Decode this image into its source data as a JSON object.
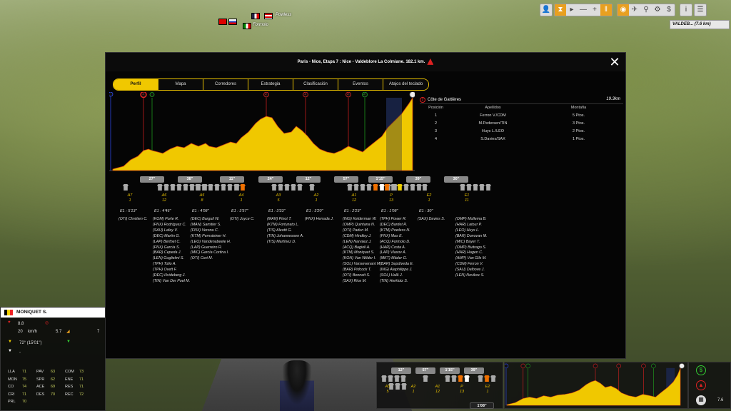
{
  "flags": {
    "labels": [
      "Powless",
      "Formolo"
    ]
  },
  "toolbar": {
    "location": "VALDEB... (7.6 km)"
  },
  "modal": {
    "title": "Paris - Nice, Etapa 7 : Nice - Valdeblore La Colmiane. 182.1 km."
  },
  "tabs": [
    "Perfil",
    "Mapa",
    "Corredores",
    "Estrategia",
    "Clasificación",
    "Eventos",
    "Atajos del teclado"
  ],
  "profile_markers": [
    "1",
    "2",
    "1",
    "2",
    "2"
  ],
  "climb": {
    "number": "2",
    "name": "Côte de Gattières",
    "distance": "19.3km",
    "headers": [
      "Posición",
      "Apellidos",
      "Montaña"
    ],
    "rows": [
      [
        "1",
        "Ferron V./CDM",
        "5 Ptos."
      ],
      [
        "2",
        "M.Pedersen/TIN",
        "3 Ptos."
      ],
      [
        "3",
        "Huys L./LEO",
        "2 Ptos."
      ],
      [
        "4",
        "S.Davies/SAX",
        "1 Ptos."
      ]
    ]
  },
  "gaps": [
    "27''",
    "38''",
    "11''",
    "24''",
    "12''",
    "57''",
    "1'15''",
    "39''",
    "30''"
  ],
  "groups": [
    {
      "label": "A7",
      "count": "1",
      "time": "E1 : 5'13''",
      "riders": [
        "(OTI) Chrétien C."
      ]
    },
    {
      "label": "A6",
      "count": "12",
      "time": "E1 : 4'46''",
      "riders": [
        "(KOM) Porte R.",
        "(FNX) Rodríguez C.",
        "(SAU) Lafay V.",
        "(DEC) Martin G.",
        "(LAP) Berthet C.",
        "(FNX) García S.",
        "(BAR) Cepeda J.",
        "(LEN) Guglielmi S.",
        "(TPH) Tolio A.",
        "(TPH) Ovett F.",
        "(DEC) Hvideberg J.",
        "(TIN) Van Der Poel M."
      ]
    },
    {
      "label": "A5",
      "count": "8",
      "time": "E1 : 4'08''",
      "riders": [
        "(DEC) Barguil W.",
        "(MAN) Samitier S.",
        "(FNX) Verona C.",
        "(KTM) Pernsteiner H.",
        "(LEO) Vandenabeele H.",
        "(LAP) Guerreiro R.",
        "(MIC) García Cortina I.",
        "(OTI) Cort M."
      ]
    },
    {
      "label": "A4",
      "count": "1",
      "time": "E1 : 3'57''",
      "riders": [
        "(OTI) Joyce C."
      ]
    },
    {
      "label": "A3",
      "count": "5",
      "time": "E1 : 3'33''",
      "riders": [
        "(MAN) Pinot T.",
        "(KTM) Fortunato L.",
        "(TIS) Aleotti G.",
        "(TIN) Johannessen A.",
        "(TIS) Martínez D."
      ]
    },
    {
      "label": "A2",
      "count": "1",
      "time": "E1 : 3'20''",
      "riders": [
        "(FNX) Herrada J."
      ]
    },
    {
      "label": "A1",
      "count": "12",
      "time": "E1 : 2'23''",
      "riders": [
        "(ING) Kelderman W.",
        "(OMP) Quintana N.",
        "(OTI) Padun M.",
        "(CDM) Hindley J.",
        "(LEN) Narváez J.",
        "(ACQ) Bagioli A.",
        "(KTM) Moniquet S.",
        "(KON) Van Wilder I.",
        "(SOL) Vansevenant M.",
        "(BAR) Pidcock T.",
        "(OTI) Bennett S.",
        "(SAX) Rice M."
      ]
    },
    {
      "label": "P",
      "count": "13",
      "time": "E1 : 1'08''",
      "riders": [
        "(TPH) Power R.",
        "(DEC) Bardet R.",
        "(KTM) Powless N.",
        "(FNX) Mas E.",
        "(ACQ) Formolo D.",
        "(HAR) Costa A.",
        "(LAP) Vlasov A.",
        "(MKT) Mäder G.",
        "(BAR) Sepúlveda E.",
        "(ING) Alaphilippe J.",
        "(SOL) Hală J.",
        "(TIN) Herklotz S."
      ]
    },
    {
      "label": "E2",
      "count": "1",
      "time": "E1 : 30''",
      "riders": [
        "(SAX) Davies S."
      ]
    },
    {
      "label": "E1",
      "count": "11",
      "time": "",
      "riders": [
        "(OMP) Mollema B.",
        "(HAR) Latour P.",
        "(LEO) Huys L.",
        "(BAR) Donovan M.",
        "(MIC) Bayer T.",
        "(OMP) Buitrago S.",
        "(HAR) Hagen C.",
        "(AMP) Van Gils M.",
        "(CDM) Ferron V.",
        "(SAU) Delbove J.",
        "(LEN) Novikov S."
      ]
    }
  ],
  "rider_card": {
    "name": "MONIQUET S.",
    "val1": "8.8",
    "speed": "20",
    "speed_unit": "km/h",
    "grade": "5.7",
    "count": "7",
    "position": "72° (15'01'')",
    "dash": "-"
  },
  "stats": [
    [
      "LLA",
      "71",
      "PAV",
      "63",
      "COM",
      "73"
    ],
    [
      "MON",
      "75",
      "SPR",
      "62",
      "ENE",
      "71"
    ],
    [
      "CO",
      "74",
      "ACE",
      "69",
      "RES",
      "71"
    ],
    [
      "CRI",
      "71",
      "DES",
      "70",
      "REC",
      "72"
    ],
    [
      "PRL",
      "70",
      "",
      "",
      "",
      ""
    ]
  ],
  "mini": {
    "gaps": [
      "12''",
      "57''",
      "1'15''",
      "39''"
    ],
    "labels": [
      [
        "A3",
        "5"
      ],
      [
        "A2",
        "1"
      ],
      [
        "A1",
        "12"
      ],
      [
        "P",
        "13"
      ],
      [
        "E2",
        "1"
      ]
    ],
    "bottom": "1'08''",
    "km": "7.6"
  }
}
